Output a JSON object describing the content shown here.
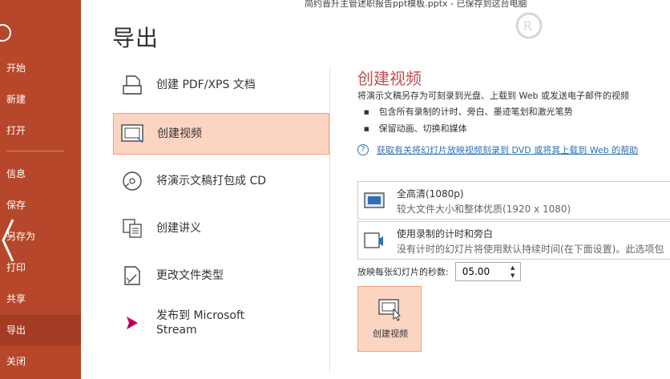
{
  "window": {
    "title": "简约晋升主管述职报告ppt模板.pptx - 已保存到这台电脑"
  },
  "sidebar": {
    "items": [
      {
        "label": "开始"
      },
      {
        "label": "新建"
      },
      {
        "label": "打开"
      },
      {
        "label": "信息"
      },
      {
        "label": "保存"
      },
      {
        "label": "另存为"
      },
      {
        "label": "打印"
      },
      {
        "label": "共享"
      },
      {
        "label": "导出"
      },
      {
        "label": "关闭"
      }
    ],
    "active": "导出"
  },
  "page": {
    "title": "导出"
  },
  "options": [
    {
      "label": "创建 PDF/XPS 文档",
      "icon": "pdf-document-icon"
    },
    {
      "label": "创建视频",
      "icon": "video-film-icon"
    },
    {
      "label": "将演示文稿打包成 CD",
      "icon": "cd-disc-icon"
    },
    {
      "label": "创建讲义",
      "icon": "handout-icon"
    },
    {
      "label": "更改文件类型",
      "icon": "change-file-type-icon"
    },
    {
      "label_line1": "发布到 Microsoft",
      "label_line2": "Stream",
      "icon": "stream-icon"
    }
  ],
  "panel": {
    "title": "创建视频",
    "description": "将演示文稿另存为可刻录到光盘、上载到 Web 或发送电子邮件的视频",
    "bullets": [
      "包含所有录制的计时、旁白、墨迹笔划和激光笔势",
      "保留动画、切换和媒体"
    ],
    "help_link": "获取有关将幻灯片放映视频刻录到 DVD 或将其上载到 Web 的帮助",
    "quality": {
      "main": "全高清(1080p)",
      "sub": "较大文件大小和整体优质(1920 x 1080)"
    },
    "timing": {
      "main": "使用录制的计时和旁白",
      "sub": "没有计时的幻灯片将使用默认持续时间(在下面设置)。此选项包"
    },
    "seconds_label": "放映每张幻灯片的秒数:",
    "seconds_value": "05.00",
    "create_button": "创建视频"
  },
  "colors": {
    "sidebar": "#b7472a",
    "accent_title": "#c0504d",
    "selected_fill": "#fcd5c2",
    "link": "#2f6fb5"
  }
}
